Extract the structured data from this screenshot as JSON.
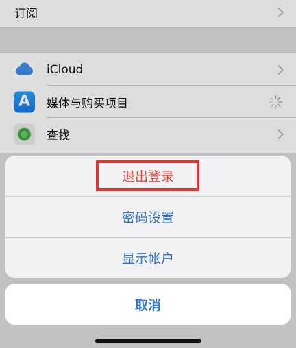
{
  "settings": {
    "subscriptions_label": "订阅",
    "icloud_label": "iCloud",
    "media_purchases_label": "媒体与购买项目",
    "find_my_label": "查找"
  },
  "action_sheet": {
    "sign_out_label": "退出登录",
    "password_settings_label": "密码设置",
    "show_account_label": "显示帐户",
    "cancel_label": "取消"
  },
  "icons": [
    "chevron-right-icon",
    "icloud-icon",
    "app-store-icon",
    "find-my-icon",
    "loading-spinner-icon"
  ],
  "colors": {
    "destructive": "#e7443a",
    "action_blue": "#2f74c9",
    "highlight_box": "#e23434"
  }
}
